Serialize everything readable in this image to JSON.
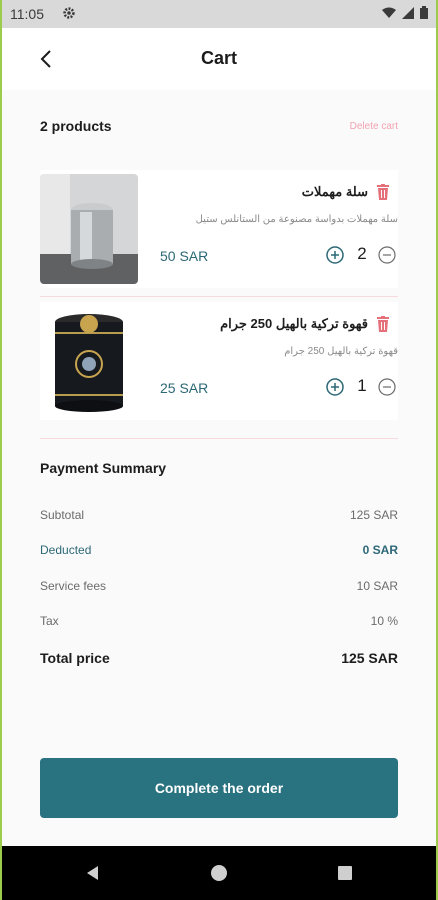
{
  "status": {
    "time": "11:05"
  },
  "appbar": {
    "title": "Cart"
  },
  "cart": {
    "count_label": "2 products",
    "delete_label": "Delete cart",
    "items": [
      {
        "name": "سلة مهملات",
        "description": "سلة مهملات بدواسة مصنوعة من الستانلس ستيل",
        "price": "50 SAR",
        "quantity": "2"
      },
      {
        "name": "قهوة تركية بالهيل 250 جرام",
        "description": "قهوة تركية بالهيل 250 جرام",
        "price": "25 SAR",
        "quantity": "1"
      }
    ]
  },
  "summary": {
    "title": "Payment Summary",
    "rows": [
      {
        "label": "Subtotal",
        "value": "125 SAR"
      },
      {
        "label": "Deducted",
        "value": "0 SAR"
      },
      {
        "label": "Service fees",
        "value": "10 SAR"
      },
      {
        "label": "Tax",
        "value": "10 %"
      },
      {
        "label": "Total price",
        "value": "125 SAR"
      }
    ]
  },
  "cta": {
    "label": "Complete the order"
  },
  "colors": {
    "accent": "#29727f",
    "delete": "#f2a3b2",
    "trash": "#e5707a"
  },
  "icons": [
    "settings-icon",
    "wifi-icon",
    "signal-icon",
    "battery-icon",
    "back-arrow-icon",
    "trash-icon",
    "plus-circle-icon",
    "minus-circle-icon",
    "nav-back-icon",
    "nav-home-icon",
    "nav-recents-icon"
  ]
}
